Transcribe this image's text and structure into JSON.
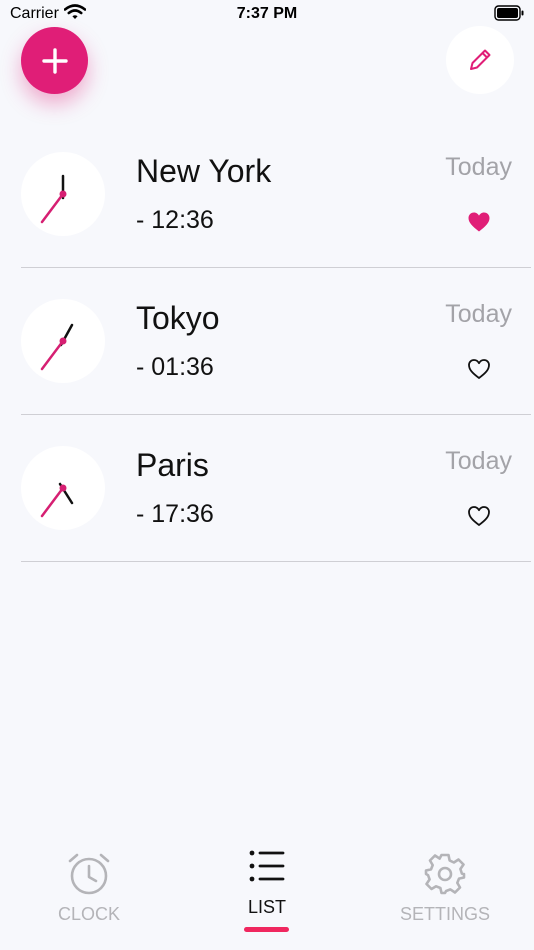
{
  "status_bar": {
    "carrier": "Carrier",
    "time": "7:37 PM"
  },
  "actions": {
    "add_icon": "plus-icon",
    "edit_icon": "pencil-icon"
  },
  "cities": [
    {
      "name": "New York",
      "time": "- 12:36",
      "day": "Today",
      "favorite": true
    },
    {
      "name": "Tokyo",
      "time": "- 01:36",
      "day": "Today",
      "favorite": false
    },
    {
      "name": "Paris",
      "time": "- 17:36",
      "day": "Today",
      "favorite": false
    }
  ],
  "tabs": [
    {
      "label": "CLOCK",
      "icon": "alarm-clock-icon",
      "active": false
    },
    {
      "label": "LIST",
      "icon": "list-icon",
      "active": true
    },
    {
      "label": "SETTINGS",
      "icon": "gear-icon",
      "active": false
    }
  ],
  "colors": {
    "accent": "#e01e77",
    "tab_indicator": "#f0275f",
    "muted": "#a3a3a8",
    "background": "#f7f8fc"
  }
}
